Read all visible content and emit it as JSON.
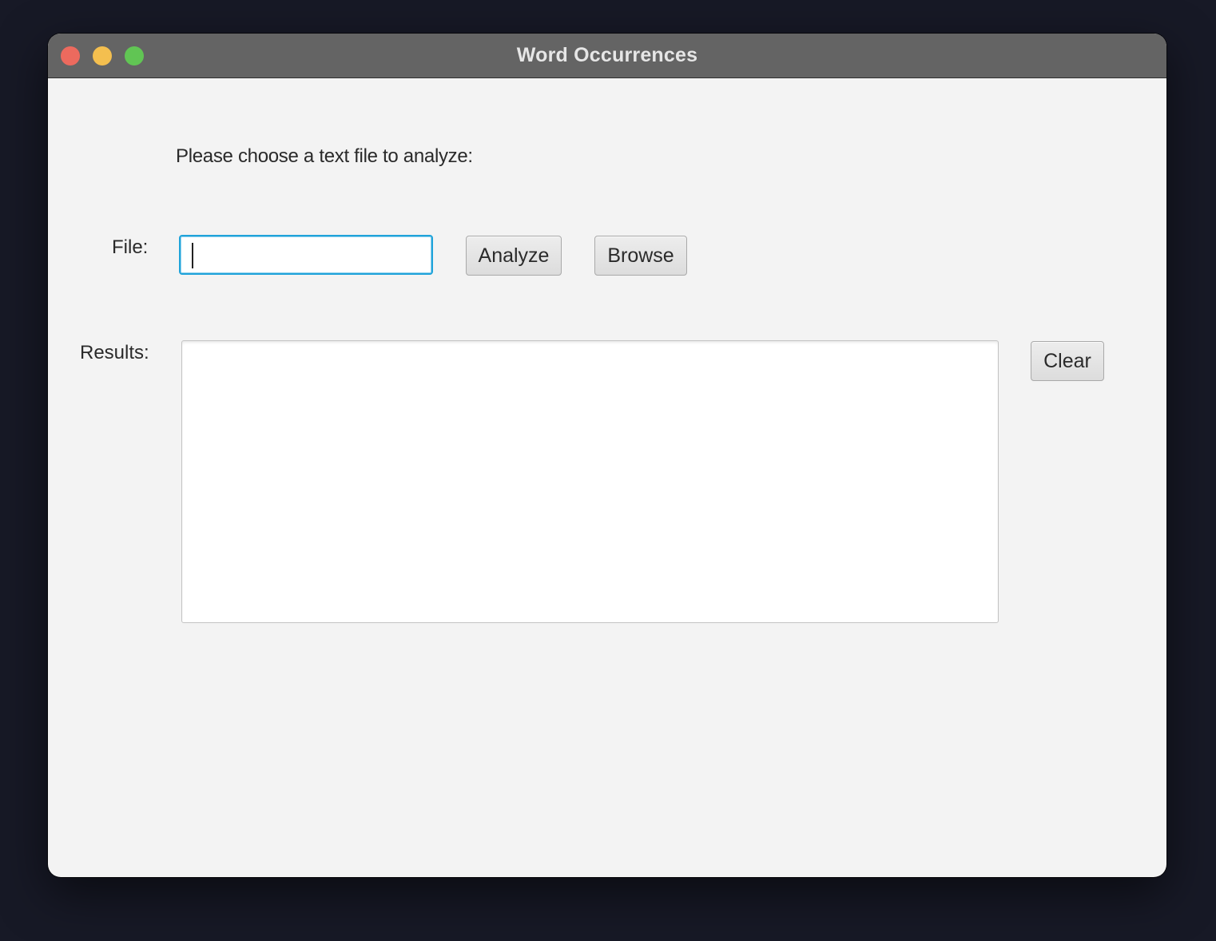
{
  "window": {
    "title": "Word Occurrences",
    "traffic_lights": {
      "close_color": "#ec6a5e",
      "minimize_color": "#f4bf4f",
      "maximize_color": "#61c554"
    }
  },
  "main": {
    "prompt": "Please choose a text file to analyze:",
    "file": {
      "label": "File:",
      "value": "",
      "placeholder": "",
      "focused": true,
      "focus_color": "#1fa3da"
    },
    "buttons": {
      "analyze_label": "Analyze",
      "browse_label": "Browse",
      "clear_label": "Clear"
    },
    "results": {
      "label": "Results:",
      "value": ""
    }
  }
}
